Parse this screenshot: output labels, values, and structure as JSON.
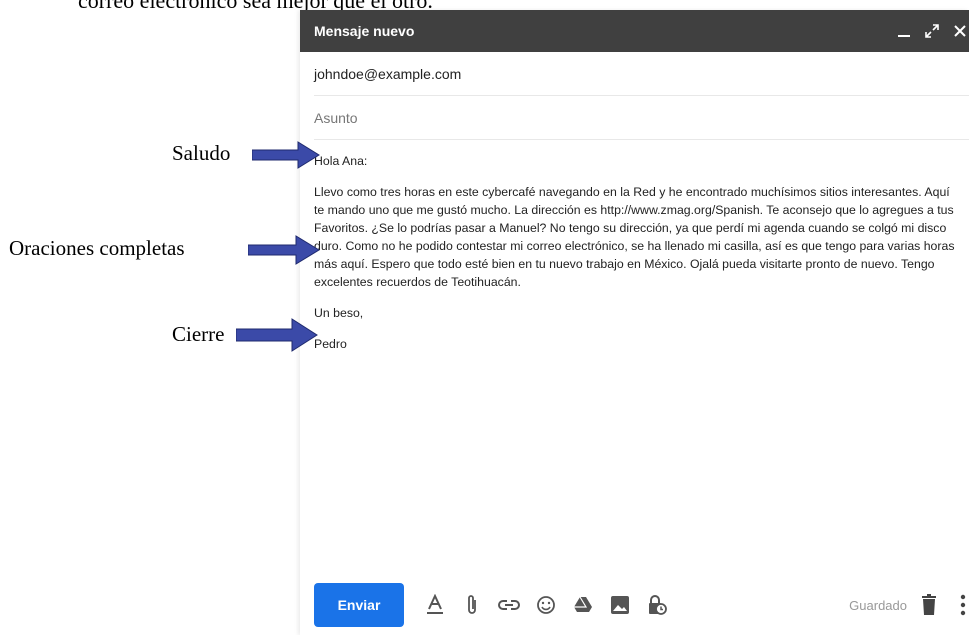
{
  "top_text": "correo electrónico sea mejor que el otro.",
  "compose": {
    "title": "Mensaje nuevo",
    "to": "johndoe@example.com",
    "subject_placeholder": "Asunto",
    "greeting": "Hola Ana:",
    "paragraph": " Llevo como tres horas en este cybercafé navegando en la Red y he encontrado muchísimos sitios interesantes. Aquí te mando uno que me gustó mucho. La dirección es http://www.zmag.org/Spanish. Te aconsejo que lo agregues a tus Favoritos. ¿Se lo podrías pasar a Manuel? No tengo su dirección, ya que perdí mi agenda cuando se colgó mi disco duro. Como no he podido contestar mi correo electrónico, se ha llenado mi casilla, así es que tengo para varias horas más aquí. Espero que todo esté bien en tu nuevo trabajo en México. Ojalá pueda visitarte pronto de nuevo. Tengo excelentes recuerdos de Teotihuacán.",
    "closing": "Un beso,",
    "signature": "Pedro",
    "send_label": "Enviar",
    "saved_label": "Guardado"
  },
  "annotations": {
    "greeting_label": "Saludo",
    "sentences_label": "Oraciones completas",
    "closing_label": "Cierre"
  },
  "colors": {
    "header": "#404040",
    "send": "#1a73e8",
    "arrow": "#3b4aa8"
  },
  "icons": [
    "minimize-icon",
    "expand-icon",
    "close-icon",
    "text-format-icon",
    "attach-icon",
    "link-icon",
    "emoji-icon",
    "drive-icon",
    "photo-icon",
    "confidential-icon",
    "trash-icon",
    "more-options-icon"
  ]
}
